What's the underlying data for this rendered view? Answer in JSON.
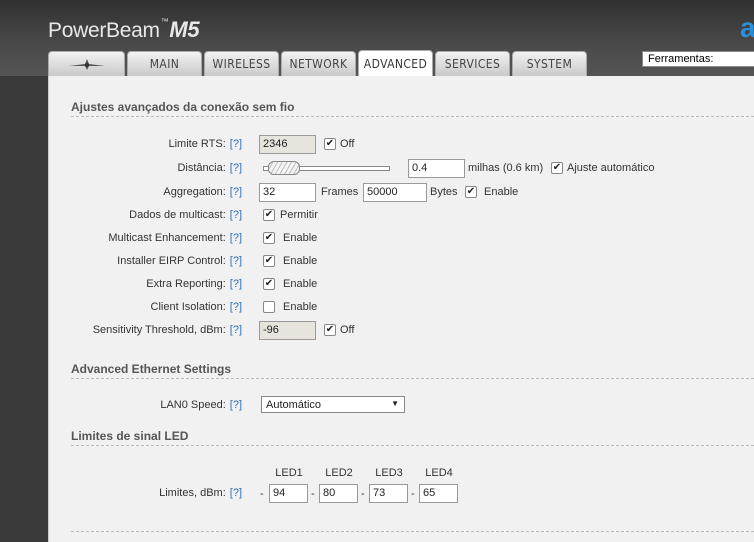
{
  "brand": {
    "name": "PowerBeam",
    "tm": "™",
    "model": "M5",
    "corner_logo": "a"
  },
  "tabs": [
    {
      "label": "",
      "icon": "ubiquiti-logo-icon"
    },
    {
      "label": "MAIN"
    },
    {
      "label": "WIRELESS"
    },
    {
      "label": "NETWORK"
    },
    {
      "label": "ADVANCED",
      "active": true
    },
    {
      "label": "SERVICES"
    },
    {
      "label": "SYSTEM"
    }
  ],
  "tools": {
    "selected": "Ferramentas:"
  },
  "help_text": "[?]",
  "wireless": {
    "title": "Ajustes avançados da conexão sem fio",
    "rts": {
      "label": "Limite RTS:",
      "value": "2346",
      "off_label": "Off",
      "off_checked": true
    },
    "distance": {
      "label": "Distância:",
      "slider_fraction": 0.05,
      "value": "0.4",
      "unit_text": "milhas (0.6 km)",
      "auto_label": "Ajuste automático",
      "auto_checked": true
    },
    "aggregation": {
      "label": "Aggregation:",
      "frames_value": "32",
      "frames_label": "Frames",
      "bytes_value": "50000",
      "bytes_label": "Bytes",
      "enable_label": "Enable",
      "enable_checked": true
    },
    "multicast_data": {
      "label": "Dados de multicast:",
      "option_label": "Permitir",
      "checked": true
    },
    "multicast_enh": {
      "label": "Multicast Enhancement:",
      "option_label": "Enable",
      "checked": true
    },
    "eirp": {
      "label": "Installer EIRP Control:",
      "option_label": "Enable",
      "checked": true
    },
    "extra": {
      "label": "Extra Reporting:",
      "option_label": "Enable",
      "checked": true
    },
    "isolation": {
      "label": "Client Isolation:",
      "option_label": "Enable",
      "checked": false
    },
    "sensitivity": {
      "label": "Sensitivity Threshold, dBm:",
      "value": "-96",
      "off_label": "Off",
      "off_checked": true
    }
  },
  "ethernet": {
    "title": "Advanced Ethernet Settings",
    "lan0": {
      "label": "LAN0 Speed:",
      "value": "Automático"
    }
  },
  "led": {
    "title": "Limites de sinal LED",
    "headers": [
      "LED1",
      "LED2",
      "LED3",
      "LED4"
    ],
    "label": "Limites, dBm:",
    "dash": "-",
    "values": [
      "94",
      "80",
      "73",
      "65"
    ]
  }
}
